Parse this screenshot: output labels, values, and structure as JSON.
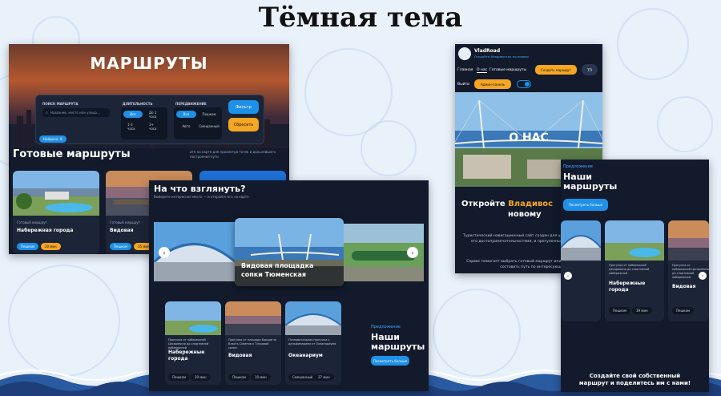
{
  "slide": {
    "title": "Тёмная тема"
  },
  "routes_page": {
    "hero_title": "МАРШРУТЫ",
    "filter": {
      "search_label": "ПОИСК МАРШРУТА",
      "search_placeholder": "Название, место или улица...",
      "duration_label": "ДЛИТЕЛЬНОСТЬ",
      "duration_options": [
        "Все",
        "До 1 часа",
        "1-3 часа",
        "3+ часа"
      ],
      "transport_label": "ПЕРЕДВИЖЕНИЕ",
      "transport_options": [
        "Все",
        "Пешком",
        "Авто",
        "Смешанный"
      ],
      "apply_button": "Фильтр",
      "reset_button": "Сбросить",
      "found_badge": "Найдено: 8"
    },
    "section_title": "Готовые маршруты",
    "note": "ите на карте для просмотра точек и дальнейшего построения пути",
    "cards": [
      {
        "tag": "Готовый маршрут",
        "title": "Набережная города",
        "mode": "Пешком",
        "time": "20 мин"
      },
      {
        "tag": "Готовый маршрут",
        "title": "Видовая",
        "mode": "Пешком",
        "time": "35 мин"
      }
    ]
  },
  "see_page": {
    "title": "На что взглянуть?",
    "subtitle": "Выберите интересное место — и откройте его на карте.",
    "featured_caption": "Видовая площадка сопки Тюменская",
    "offer_label": "Предложение",
    "offer_title": "Наши маршруты",
    "offer_button": "Посмотреть больше",
    "cards": [
      {
        "desc": "Прогулка от набережной Цесаревича до спортивной набережной",
        "title": "Набережные города",
        "mode": "Пешком",
        "time": "20 мин"
      },
      {
        "desc": "Прогулка от площади Борцов за Власть Советов к Тигровой сопке",
        "title": "Видовая",
        "mode": "Пешком",
        "time": "10 мин"
      },
      {
        "desc": "Познавательная прогулка с дельфинарием от Океанариума",
        "title": "Океанариум",
        "mode": "Смешанный",
        "time": "27 мин"
      }
    ]
  },
  "about_page": {
    "logo_name": "VladRoad",
    "logo_tagline": "Откройте Владивосток по-новому",
    "nav": [
      "Главная",
      "О нас",
      "Готовые маршруты"
    ],
    "create_button": "Создать маршрут",
    "avatar_text": "ТП",
    "logout": "Выйти",
    "admin_button": "Админ-панель",
    "hero_title": "О НАС",
    "title_part1": "Откройте ",
    "title_highlight": "Владивос",
    "title_part2": "новому",
    "body1": "Туристический навигационный сайт создан для удо с Владивостоком, его достопримечательностями, и прогулочными маршрутами.",
    "body2": "Сервис помогает выбрать готовый маршрут или п самостоятельно составить путь по интересующи"
  },
  "mobile_routes": {
    "offer_label": "Предложение",
    "offer_title": "Наши маршруты",
    "offer_button": "Посмотреть больше",
    "cards": [
      {
        "desc": "Прогулка от набережной Цесаревича до спортивной набережной",
        "title": "Набережные города",
        "mode": "Пешком",
        "time": "39 мин"
      },
      {
        "desc": "Прогулка от набережной Цесаревича до спортивной набережной",
        "title": "Видовая",
        "mode": "Пешком",
        "time": "10 мин"
      }
    ],
    "cta": "Создайте свой собственный маршрут и поделитесь им с нами!"
  },
  "colors": {
    "accent_blue": "#1e90e8",
    "accent_orange": "#f5a623",
    "panel_bg": "#121a2b"
  }
}
